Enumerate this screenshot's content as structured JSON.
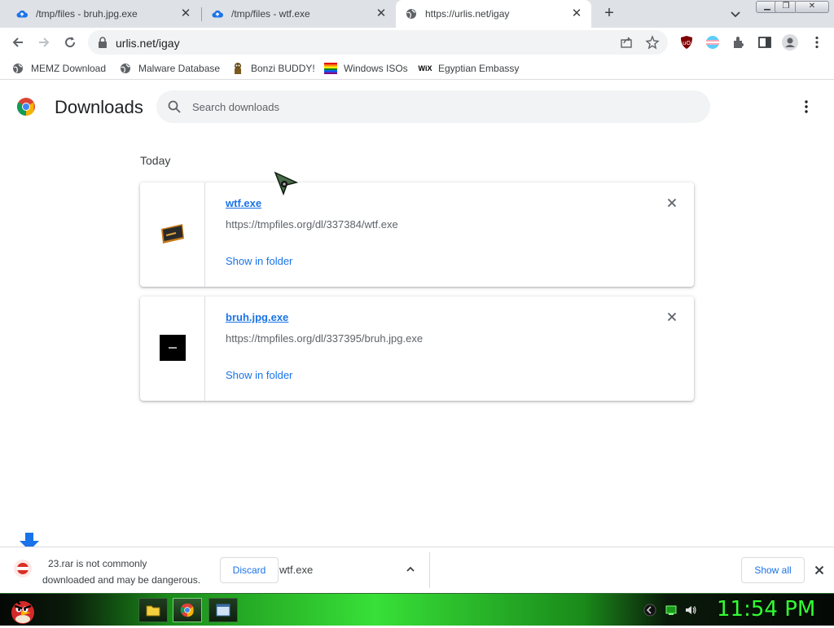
{
  "tabs": [
    {
      "title": "/tmp/files - bruh.jpg.exe",
      "active": false
    },
    {
      "title": "/tmp/files - wtf.exe",
      "active": false
    },
    {
      "title": "https://urlis.net/igay",
      "active": true
    }
  ],
  "toolbar": {
    "url": "urlis.net/igay"
  },
  "bookmarks": [
    {
      "label": "MEMZ Download",
      "icon": "globe-icon"
    },
    {
      "label": "Malware Database",
      "icon": "globe-icon"
    },
    {
      "label": "Bonzi BUDDY!",
      "icon": "bonzi-icon"
    },
    {
      "label": "Windows ISOs",
      "icon": "rainbow-flag-icon"
    },
    {
      "label": "Egyptian Embassy",
      "icon": "wix-icon"
    }
  ],
  "downloads": {
    "title": "Downloads",
    "search_placeholder": "Search downloads",
    "section": "Today",
    "items": [
      {
        "file": "wtf.exe",
        "url": "https://tmpfiles.org/dl/337384/wtf.exe",
        "action": "Show in folder"
      },
      {
        "file": "bruh.jpg.exe",
        "url": "https://tmpfiles.org/dl/337395/bruh.jpg.exe",
        "action": "Show in folder"
      }
    ]
  },
  "shelf": {
    "warning_line1": "23.rar is not commonly",
    "warning_line2": "downloaded and may be dangerous.",
    "discard": "Discard",
    "item2": "wtf.exe",
    "show_all": "Show all"
  },
  "taskbar": {
    "clock": "11:54 PM"
  },
  "colors": {
    "accent": "#1a73e8",
    "clock": "#32ff32",
    "tabstrip": "#dee1e6"
  }
}
